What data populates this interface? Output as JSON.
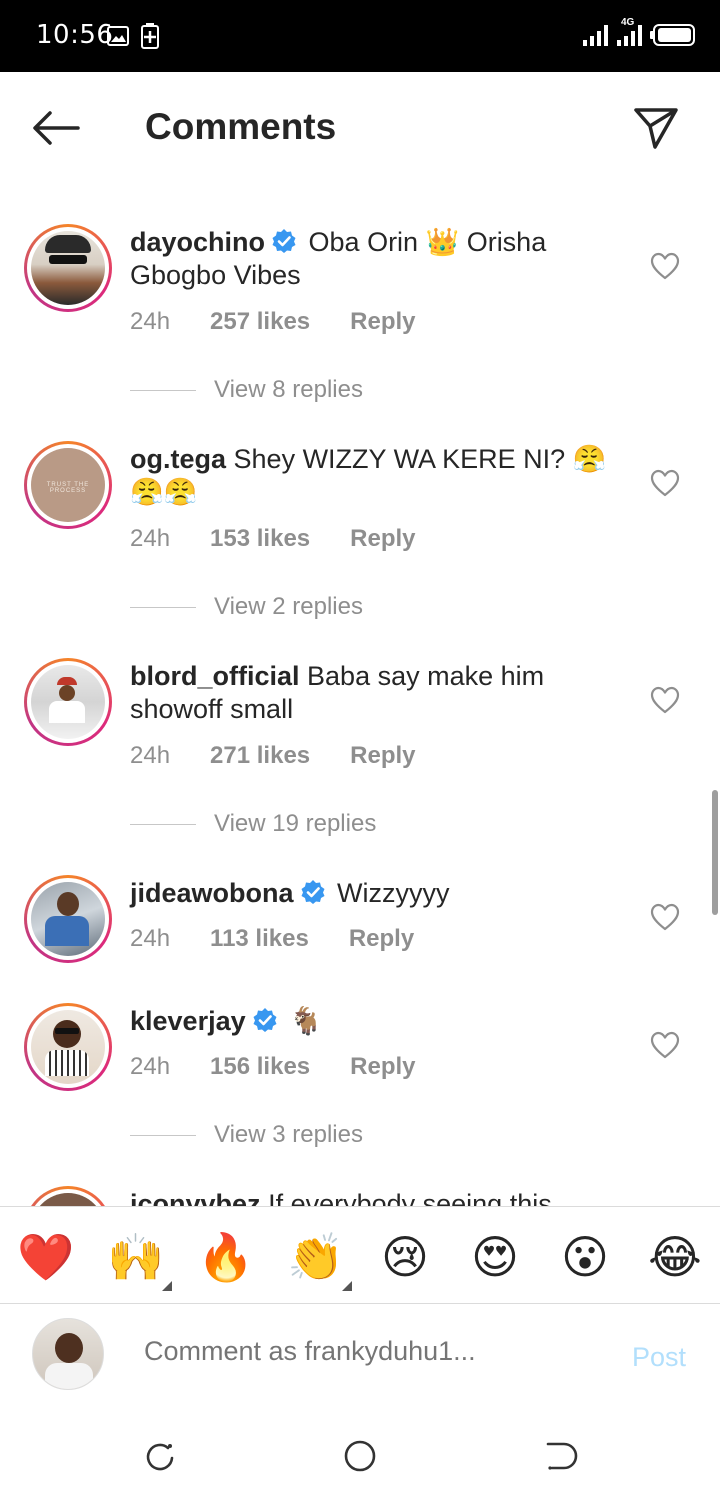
{
  "status_bar": {
    "time": "10:56",
    "network": "4G"
  },
  "header": {
    "title": "Comments"
  },
  "comments": [
    {
      "username": "dayochino",
      "verified": true,
      "text": "Oba Orin 👑 Orisha Gbogbo Vibes",
      "time": "24h",
      "likes": "257 likes",
      "reply": "Reply",
      "view_replies": "View 8 replies"
    },
    {
      "username": "og.tega",
      "verified": false,
      "text": "Shey WIZZY WA KERE NI? 😤😤😤",
      "time": "24h",
      "likes": "153 likes",
      "reply": "Reply",
      "view_replies": "View 2 replies"
    },
    {
      "username": "blord_official",
      "verified": false,
      "text": "Baba say make him showoff small",
      "time": "24h",
      "likes": "271 likes",
      "reply": "Reply",
      "view_replies": "View 19 replies"
    },
    {
      "username": "jideawobona",
      "verified": true,
      "text": "Wizzyyyy",
      "time": "24h",
      "likes": "113 likes",
      "reply": "Reply"
    },
    {
      "username": "kleverjay",
      "verified": true,
      "text": "🐐",
      "time": "24h",
      "likes": "156 likes",
      "reply": "Reply",
      "view_replies": "View 3 replies"
    },
    {
      "username": "iconyvbez",
      "text": "If everybody seeing this"
    }
  ],
  "reactions": [
    "❤️",
    "🙌",
    "🔥",
    "👏",
    "😢",
    "😍",
    "😮",
    "😂"
  ],
  "composer": {
    "placeholder": "Comment as frankyduhu1...",
    "post_label": "Post"
  },
  "colors": {
    "verified": "#3897f0",
    "post_disabled": "#b2dffc",
    "secondary_text": "#8e8e8e"
  }
}
